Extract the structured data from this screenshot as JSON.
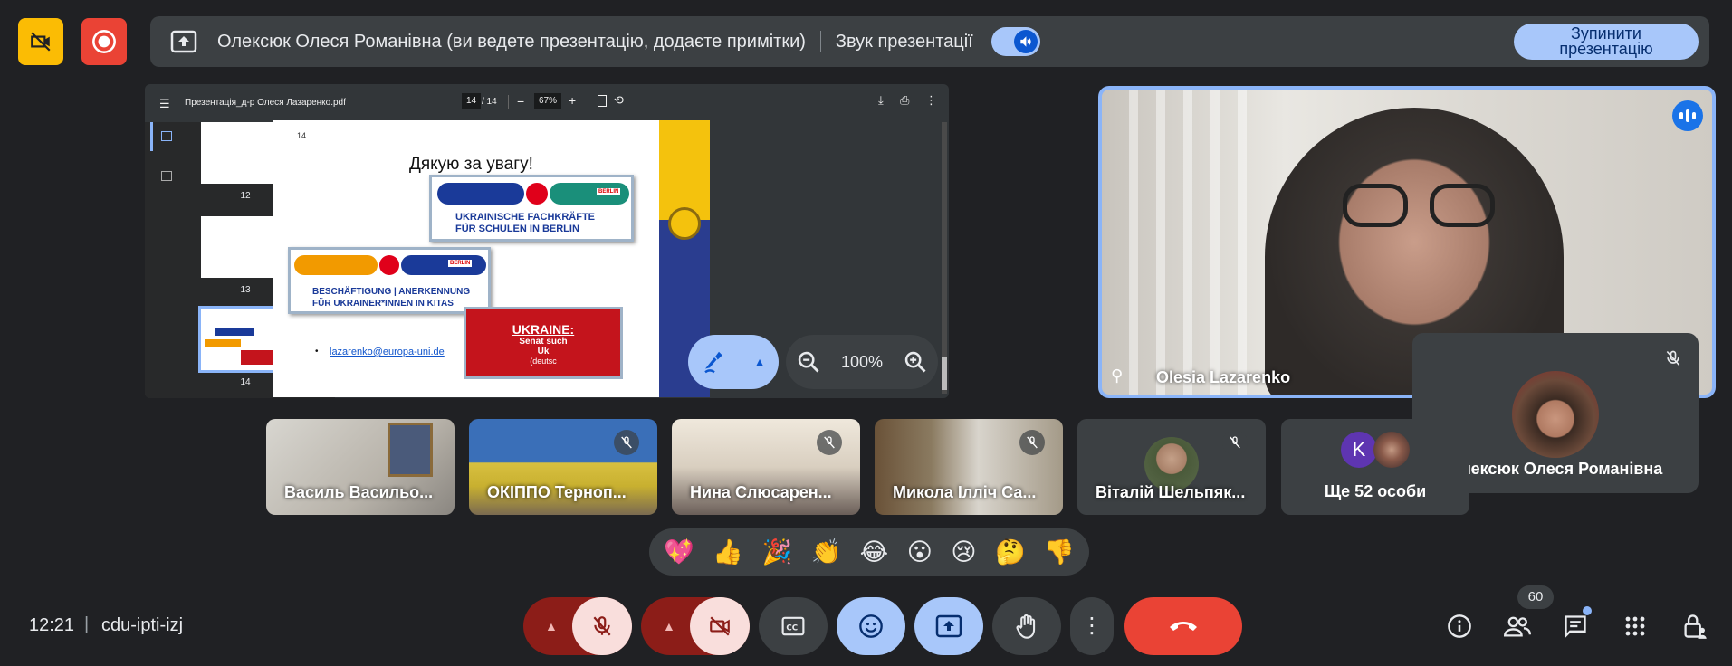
{
  "top": {
    "banner_text": "Олексюк Олеся Романівна (ви ведете презентацію, додаєте примітки)",
    "sound_label": "Звук презентації",
    "stop_line1": "Зупинити",
    "stop_line2": "презентацію"
  },
  "pdf": {
    "filename": "Презентація_д-р Олеся Лазаренко.pdf",
    "page_current": "14",
    "page_total": "/ 14",
    "zoom": "67%",
    "thumb_nums": [
      "12",
      "13",
      "14"
    ],
    "slide": {
      "page_num": "14",
      "title": "Дякую за увагу!",
      "logo1_line1": "UKRAINISCHE FACHKRÄFTE",
      "logo1_line2": "FÜR SCHULEN IN BERLIN",
      "logo2_line1": "BESCHÄFTIGUNG | ANERKENNUNG",
      "logo2_line2": "FÜR UKRAINER*INNEN IN KITAS",
      "berlin": "BERLIN",
      "email": "lazarenko@europa-uni.de",
      "red_title": "UKRAINE:",
      "red_line1": "Senat such",
      "red_line2": "Uk",
      "red_line3": "(deutsc"
    }
  },
  "zoom_control": {
    "value": "100%"
  },
  "speaker": {
    "name": "Olesia Lazarenko"
  },
  "self": {
    "name": "Олексюк Олеся Романівна"
  },
  "participants": [
    {
      "name": "Василь Васильо...",
      "muted": false
    },
    {
      "name": "ОКІППО Терноп...",
      "muted": true
    },
    {
      "name": "Нина Слюсарен...",
      "muted": true
    },
    {
      "name": "Микола Ілліч Са...",
      "muted": true
    },
    {
      "name": "Віталій Шельпяк...",
      "muted": true
    }
  ],
  "others": {
    "label": "Ще 52 особи",
    "avatar_letter": "K"
  },
  "reactions": [
    "💖",
    "👍",
    "🎉",
    "👏",
    "😂",
    "😮",
    "😢",
    "🤔",
    "👎"
  ],
  "bottom": {
    "time": "12:21",
    "separator": "|",
    "meeting_code": "cdu-ipti-izj",
    "people_count": "60"
  },
  "colors": {
    "background": "#202124",
    "accent": "#a8c7fa",
    "danger": "#ea4335",
    "record": "#ea4335",
    "warn": "#fbbc04"
  }
}
